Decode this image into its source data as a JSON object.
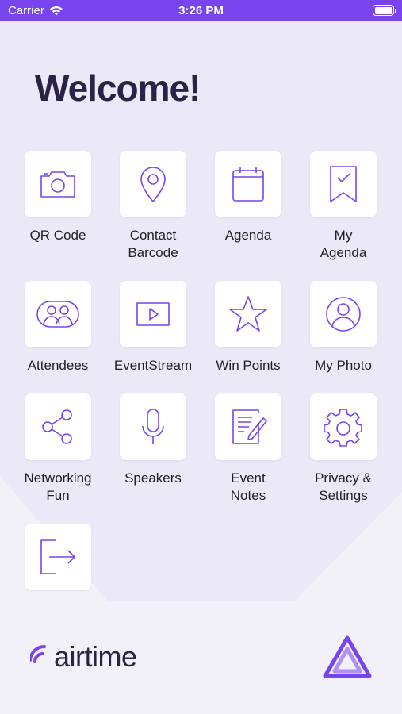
{
  "status_bar": {
    "carrier": "Carrier",
    "time": "3:26 PM"
  },
  "header": {
    "title": "Welcome!"
  },
  "tiles": [
    {
      "label": "QR Code",
      "icon": "camera-icon"
    },
    {
      "label": "Contact\nBarcode",
      "icon": "map-pin-icon"
    },
    {
      "label": "Agenda",
      "icon": "calendar-icon"
    },
    {
      "label": "My\nAgenda",
      "icon": "bookmark-check-icon"
    },
    {
      "label": "Attendees",
      "icon": "attendees-icon"
    },
    {
      "label": "EventStream",
      "icon": "video-play-icon"
    },
    {
      "label": "Win Points",
      "icon": "star-icon"
    },
    {
      "label": "My Photo",
      "icon": "user-circle-icon"
    },
    {
      "label": "Networking\nFun",
      "icon": "share-icon"
    },
    {
      "label": "Speakers",
      "icon": "microphone-icon"
    },
    {
      "label": "Event\nNotes",
      "icon": "notes-edit-icon"
    },
    {
      "label": "Privacy &\nSettings",
      "icon": "gear-icon"
    },
    {
      "label": "",
      "icon": "logout-icon"
    }
  ],
  "footer": {
    "brand_word": "airtime",
    "brand_icon": "airtime-logo-icon",
    "mark_icon": "triangle-logo-icon"
  },
  "colors": {
    "accent": "#7744ee",
    "background": "#ebe8f8",
    "title": "#2b2345"
  }
}
